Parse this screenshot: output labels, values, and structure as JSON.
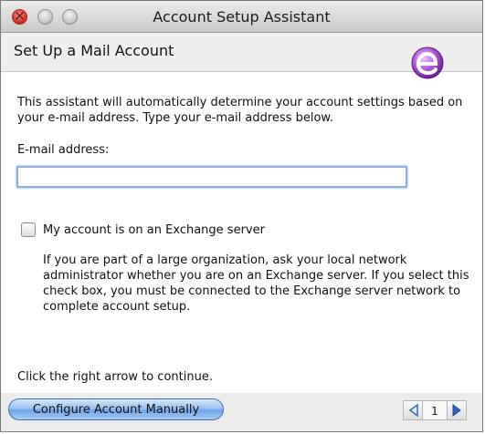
{
  "window": {
    "title": "Account Setup Assistant"
  },
  "header": {
    "title": "Set Up a Mail Account",
    "logo_icon": "entourage-e-logo-icon"
  },
  "main": {
    "intro": "This assistant will automatically determine your account settings based on your e-mail address. Type your e-mail address below.",
    "email_label": "E-mail address:",
    "email_value": "",
    "exchange_checkbox": {
      "label": "My account is on an Exchange server",
      "checked": false
    },
    "exchange_help": "If you are part of a large organization, ask your local network administrator whether you are on an Exchange server. If you select this check box, you must be connected to the Exchange server network to complete account setup.",
    "continue_hint": "Click the right arrow to continue."
  },
  "footer": {
    "configure_button": "Configure Account Manually",
    "page_number": "1",
    "prev_icon": "left-arrow-icon",
    "next_icon": "right-arrow-icon"
  },
  "colors": {
    "button_blue": "#9cc3f0",
    "focus_ring": "#8fb0dc",
    "logo_purple": "#8e3fb3"
  }
}
